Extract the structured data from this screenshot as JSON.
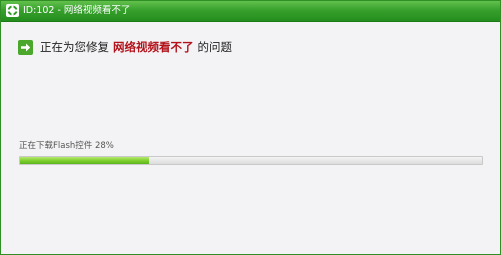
{
  "window": {
    "title": "ID:102 - 网络视频看不了"
  },
  "status": {
    "prefix": "正在为您修复",
    "issue": "网络视频看不了",
    "suffix": "的问题",
    "icon": "arrow-right-icon"
  },
  "progress": {
    "label": "正在下载Flash控件 28%",
    "fraction": 0.28
  },
  "colors": {
    "titlebar": "#2f9a25",
    "issue_highlight": "#b3121b",
    "progress_fill": "#7ccd2d",
    "status_icon": "#4aa72c"
  }
}
